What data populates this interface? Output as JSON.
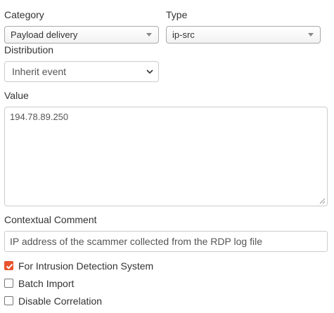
{
  "category": {
    "label": "Category",
    "value": "Payload delivery",
    "icon": "caret-down-icon"
  },
  "type": {
    "label": "Type",
    "value": "ip-src",
    "icon": "caret-down-icon"
  },
  "distribution": {
    "label": "Distribution",
    "value": "Inherit event",
    "icon": "chevron-down-icon"
  },
  "value_field": {
    "label": "Value",
    "value": "194.78.89.250"
  },
  "comment": {
    "label": "Contextual Comment",
    "value": "IP address of the scammer collected from the RDP log file"
  },
  "checkboxes": [
    {
      "label": "For Intrusion Detection System",
      "checked": true
    },
    {
      "label": "Batch Import",
      "checked": false
    },
    {
      "label": "Disable Correlation",
      "checked": false
    }
  ],
  "colors": {
    "accent": "#e8542d",
    "border": "#cccccc",
    "text": "#333333"
  }
}
